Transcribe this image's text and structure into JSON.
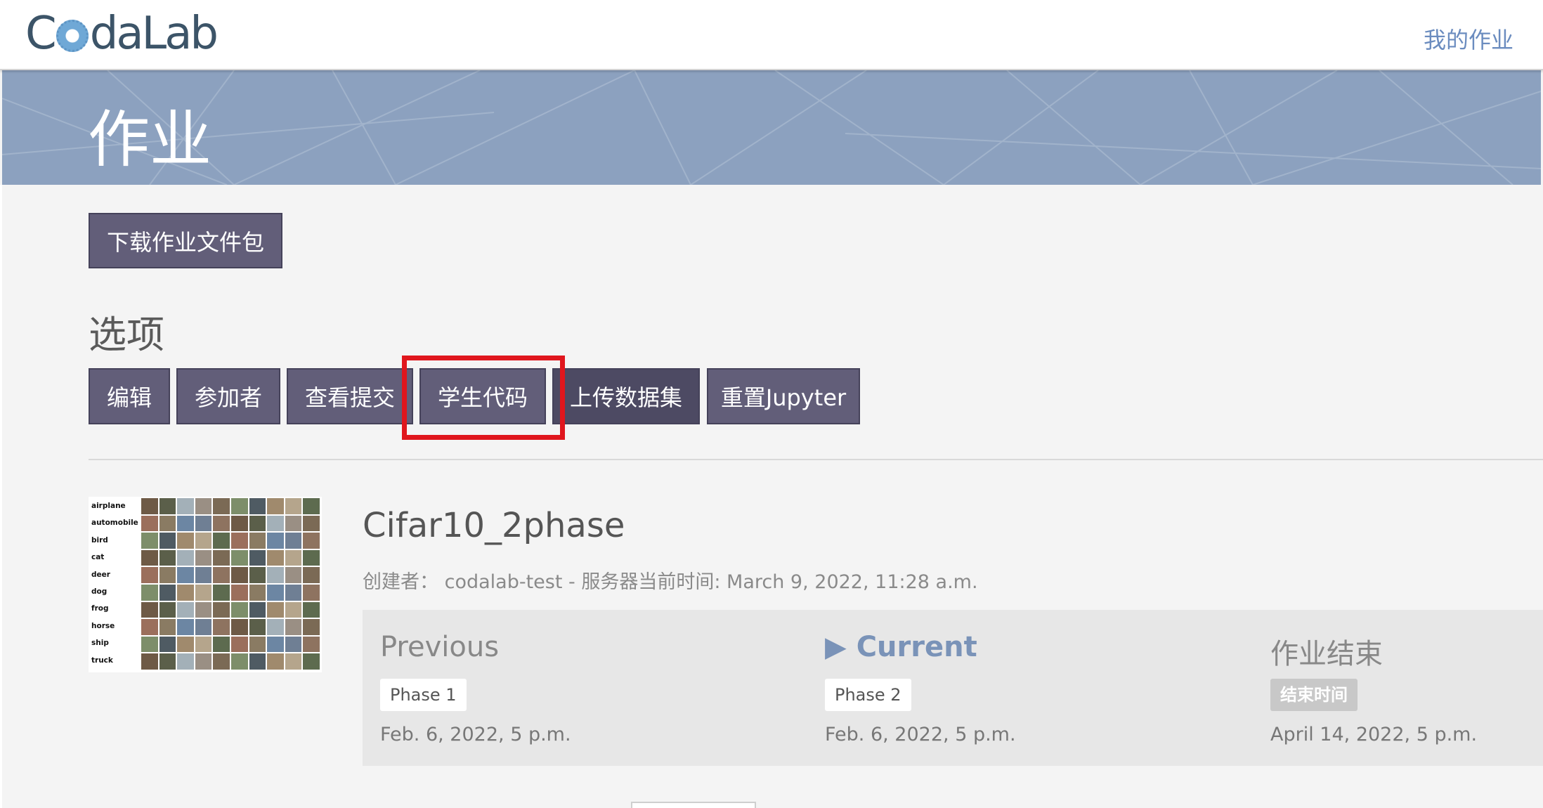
{
  "navbar": {
    "logo_text_a": "C",
    "logo_text_b": "daLab",
    "my_assignments_link": "我的作业"
  },
  "banner": {
    "title": "作业"
  },
  "download_button": "下载作业文件包",
  "options": {
    "title": "选项",
    "buttons": [
      "编辑",
      "参加者",
      "查看提交",
      "学生代码",
      "上传数据集",
      "重置Jupyter"
    ],
    "highlighted": "学生代码"
  },
  "competition": {
    "title": "Cifar10_2phase",
    "creator_label": "创建者：",
    "creator": "codalab-test",
    "server_time_label": " - 服务器当前时间: ",
    "server_time": "March 9, 2022, 11:28 a.m.",
    "thumbnail_labels": [
      "airplane",
      "automobile",
      "bird",
      "cat",
      "deer",
      "dog",
      "frog",
      "horse",
      "ship",
      "truck"
    ]
  },
  "phases": [
    {
      "heading": "Previous",
      "badge": "Phase 1",
      "date": "Feb. 6, 2022, 5 p.m."
    },
    {
      "heading": "Current",
      "badge": "Phase 2",
      "date": "Feb. 6, 2022, 5 p.m."
    },
    {
      "heading": "作业结束",
      "badge": "结束时间",
      "date": "April 14, 2022, 5 p.m."
    }
  ],
  "current_marker": "▶",
  "colors": {
    "banner": "#8ca1bf",
    "button": "#625e79",
    "highlight": "#e0161d",
    "link": "#6b8cbf"
  }
}
